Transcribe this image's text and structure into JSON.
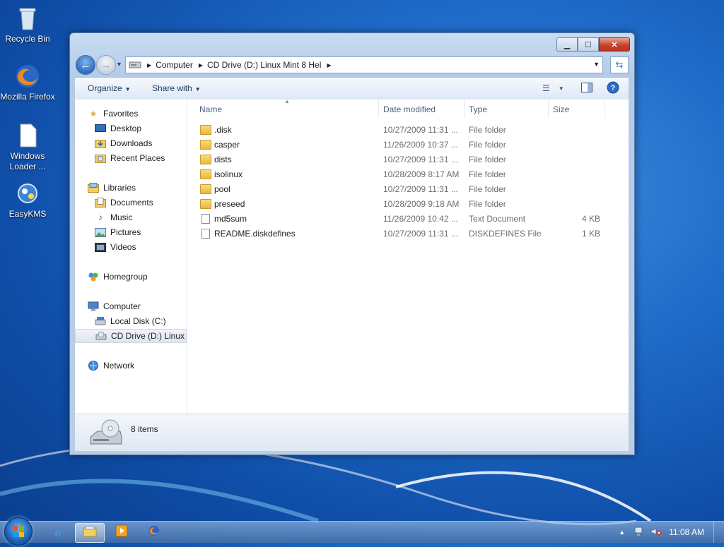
{
  "desktop": {
    "icons": [
      {
        "label": "Recycle Bin",
        "icon": "recycle-bin-icon"
      },
      {
        "label": "Mozilla Firefox",
        "icon": "firefox-icon"
      },
      {
        "label": "Windows Loader ...",
        "icon": "file-icon"
      },
      {
        "label": "EasyKMS",
        "icon": "easykms-icon"
      }
    ]
  },
  "window": {
    "address": {
      "crumbs": [
        "Computer",
        "CD Drive (D:) Linux Mint 8 Hel"
      ]
    },
    "toolbar": {
      "organize": "Organize",
      "share_with": "Share with"
    },
    "nav": {
      "favorites": "Favorites",
      "desktop": "Desktop",
      "downloads": "Downloads",
      "recent": "Recent Places",
      "libraries": "Libraries",
      "documents": "Documents",
      "music": "Music",
      "pictures": "Pictures",
      "videos": "Videos",
      "homegroup": "Homegroup",
      "computer": "Computer",
      "local_disk": "Local Disk (C:)",
      "cd_drive": "CD Drive (D:) Linux N",
      "network": "Network"
    },
    "columns": {
      "name": "Name",
      "date": "Date modified",
      "type": "Type",
      "size": "Size"
    },
    "files": [
      {
        "name": ".disk",
        "date": "10/27/2009 11:31 ...",
        "type": "File folder",
        "size": "",
        "kind": "folder"
      },
      {
        "name": "casper",
        "date": "11/26/2009 10:37 ...",
        "type": "File folder",
        "size": "",
        "kind": "folder"
      },
      {
        "name": "dists",
        "date": "10/27/2009 11:31 ...",
        "type": "File folder",
        "size": "",
        "kind": "folder"
      },
      {
        "name": "isolinux",
        "date": "10/28/2009 8:17 AM",
        "type": "File folder",
        "size": "",
        "kind": "folder"
      },
      {
        "name": "pool",
        "date": "10/27/2009 11:31 ...",
        "type": "File folder",
        "size": "",
        "kind": "folder"
      },
      {
        "name": "preseed",
        "date": "10/28/2009 9:18 AM",
        "type": "File folder",
        "size": "",
        "kind": "folder"
      },
      {
        "name": "md5sum",
        "date": "11/26/2009 10:42 ...",
        "type": "Text Document",
        "size": "4 KB",
        "kind": "document"
      },
      {
        "name": "README.diskdefines",
        "date": "10/27/2009 11:31 ...",
        "type": "DISKDEFINES File",
        "size": "1 KB",
        "kind": "document"
      }
    ],
    "details": {
      "count": "8 items"
    }
  },
  "taskbar": {
    "clock": "11:08 AM"
  }
}
